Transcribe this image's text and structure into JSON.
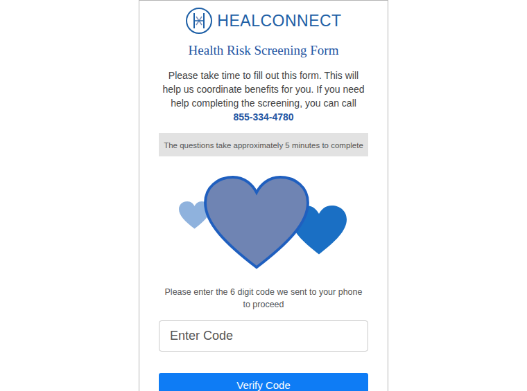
{
  "logo": {
    "text": "HEALCONNECT"
  },
  "title": "Health Risk Screening Form",
  "intro": "Please take time to fill out this form. This will help us coordinate benefits for you. If you need help completing the screening, you can call",
  "phone": "855-334-4780",
  "notice": "The questions take approximately 5 minutes to complete",
  "code_prompt": "Please enter the 6 digit code we sent to your phone to proceed",
  "code_input": {
    "placeholder": "Enter Code"
  },
  "button": "Verify Code"
}
